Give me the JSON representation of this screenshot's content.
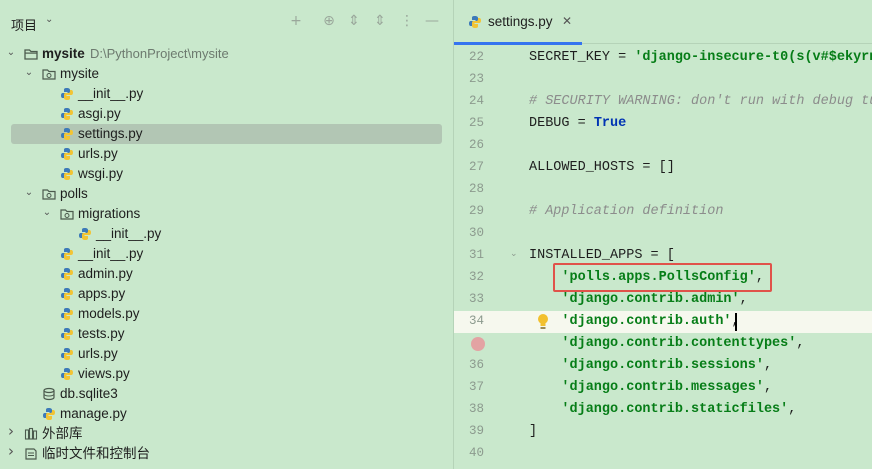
{
  "project_panel": {
    "title": "项目",
    "header_icons": [
      "add-icon",
      "target-icon",
      "expand-all-icon",
      "more-icon",
      "minimize-icon"
    ],
    "tree": [
      {
        "label": "mysite",
        "path": "D:\\PythonProject\\mysite",
        "type": "root-folder",
        "depth": 0,
        "expanded": true
      },
      {
        "label": "mysite",
        "type": "package",
        "depth": 1,
        "expanded": true
      },
      {
        "label": "__init__.py",
        "type": "python-file",
        "depth": 2
      },
      {
        "label": "asgi.py",
        "type": "python-file",
        "depth": 2
      },
      {
        "label": "settings.py",
        "type": "python-file",
        "depth": 2,
        "selected": true
      },
      {
        "label": "urls.py",
        "type": "python-file",
        "depth": 2
      },
      {
        "label": "wsgi.py",
        "type": "python-file",
        "depth": 2
      },
      {
        "label": "polls",
        "type": "package",
        "depth": 1,
        "expanded": true
      },
      {
        "label": "migrations",
        "type": "package",
        "depth": 2,
        "expanded": true
      },
      {
        "label": "__init__.py",
        "type": "python-file",
        "depth": 3
      },
      {
        "label": "__init__.py",
        "type": "python-file",
        "depth": 2
      },
      {
        "label": "admin.py",
        "type": "python-file",
        "depth": 2
      },
      {
        "label": "apps.py",
        "type": "python-file",
        "depth": 2
      },
      {
        "label": "models.py",
        "type": "python-file",
        "depth": 2
      },
      {
        "label": "tests.py",
        "type": "python-file",
        "depth": 2
      },
      {
        "label": "urls.py",
        "type": "python-file",
        "depth": 2
      },
      {
        "label": "views.py",
        "type": "python-file",
        "depth": 2
      },
      {
        "label": "db.sqlite3",
        "type": "database-file",
        "depth": 1
      },
      {
        "label": "manage.py",
        "type": "python-file",
        "depth": 1
      },
      {
        "label": "外部库",
        "type": "library",
        "depth": 0,
        "expanded": false
      },
      {
        "label": "临时文件和控制台",
        "type": "scratches",
        "depth": 0,
        "expanded": false
      }
    ]
  },
  "editor": {
    "tab": {
      "label": "settings.py",
      "close_icon": "close-icon"
    },
    "current_line": 34,
    "highlighted_line": 32,
    "breakpoint_line": 35,
    "lines": [
      {
        "num": "22",
        "tokens": [
          {
            "t": "SECRET_KEY = ",
            "c": "plain"
          },
          {
            "t": "'django-insecure-t0(s(v#$ekyrn",
            "c": "str"
          }
        ]
      },
      {
        "num": "23",
        "tokens": []
      },
      {
        "num": "24",
        "tokens": [
          {
            "t": "# SECURITY WARNING: don't run with debug tu",
            "c": "cm"
          }
        ]
      },
      {
        "num": "25",
        "tokens": [
          {
            "t": "DEBUG = ",
            "c": "plain"
          },
          {
            "t": "True",
            "c": "kw"
          }
        ]
      },
      {
        "num": "26",
        "tokens": []
      },
      {
        "num": "27",
        "tokens": [
          {
            "t": "ALLOWED_HOSTS = []",
            "c": "plain"
          }
        ]
      },
      {
        "num": "28",
        "tokens": []
      },
      {
        "num": "29",
        "tokens": [
          {
            "t": "# Application definition",
            "c": "cm"
          }
        ]
      },
      {
        "num": "30",
        "tokens": []
      },
      {
        "num": "31",
        "tokens": [
          {
            "t": "INSTALLED_APPS = [",
            "c": "plain"
          }
        ]
      },
      {
        "num": "32",
        "tokens": [
          {
            "t": "    ",
            "c": "plain"
          },
          {
            "t": "'polls.apps.PollsConfig'",
            "c": "str"
          },
          {
            "t": ",",
            "c": "plain"
          }
        ]
      },
      {
        "num": "33",
        "tokens": [
          {
            "t": "    ",
            "c": "plain"
          },
          {
            "t": "'django.contrib.admin'",
            "c": "str"
          },
          {
            "t": ",",
            "c": "plain"
          }
        ]
      },
      {
        "num": "34",
        "tokens": [
          {
            "t": "    ",
            "c": "plain"
          },
          {
            "t": "'django.contrib.auth'",
            "c": "str"
          },
          {
            "t": ",",
            "c": "plain"
          }
        ]
      },
      {
        "num": "",
        "tokens": [
          {
            "t": "    ",
            "c": "plain"
          },
          {
            "t": "'django.contrib.contenttypes'",
            "c": "str"
          },
          {
            "t": ",",
            "c": "plain"
          }
        ]
      },
      {
        "num": "36",
        "tokens": [
          {
            "t": "    ",
            "c": "plain"
          },
          {
            "t": "'django.contrib.sessions'",
            "c": "str"
          },
          {
            "t": ",",
            "c": "plain"
          }
        ]
      },
      {
        "num": "37",
        "tokens": [
          {
            "t": "    ",
            "c": "plain"
          },
          {
            "t": "'django.contrib.messages'",
            "c": "str"
          },
          {
            "t": ",",
            "c": "plain"
          }
        ]
      },
      {
        "num": "38",
        "tokens": [
          {
            "t": "    ",
            "c": "plain"
          },
          {
            "t": "'django.contrib.staticfiles'",
            "c": "str"
          },
          {
            "t": ",",
            "c": "plain"
          }
        ]
      },
      {
        "num": "39",
        "tokens": [
          {
            "t": "]",
            "c": "plain"
          }
        ]
      },
      {
        "num": "40",
        "tokens": []
      }
    ]
  },
  "colors": {
    "background": "#c9e8cc",
    "selection": "#b2c6b4",
    "current_line": "#f6f8ee",
    "highlight_box": "#e0524a",
    "tab_underline": "#3574f0",
    "string": "#067d17",
    "keyword": "#0033b3",
    "comment": "#8c8c8c"
  }
}
